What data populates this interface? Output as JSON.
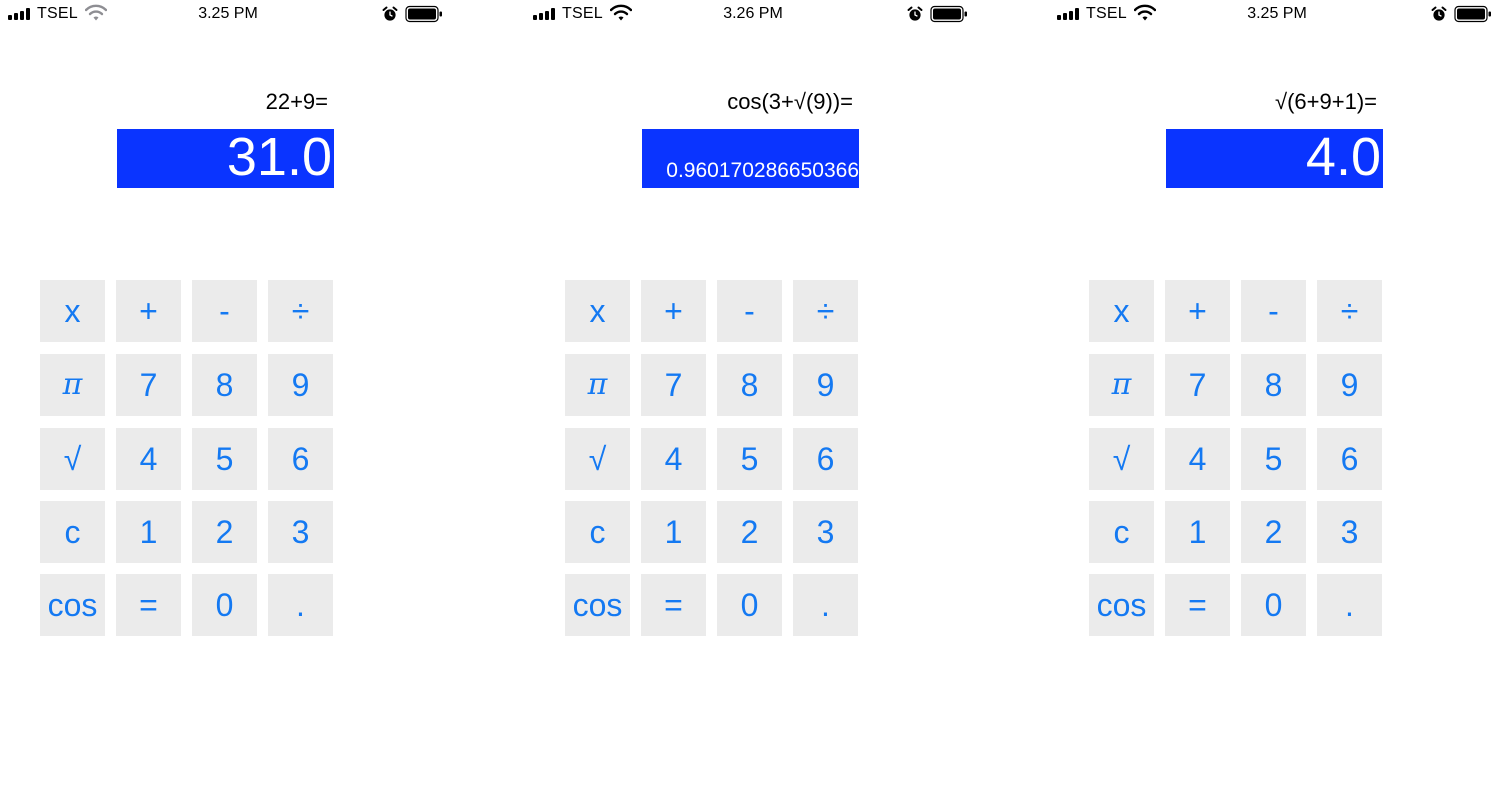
{
  "screens": [
    {
      "status": {
        "carrier": "TSEL",
        "time": "3.25 PM"
      },
      "expression": "22+9=",
      "result": "31.0",
      "result_size": "big",
      "wifi_color": "#8e8e93"
    },
    {
      "status": {
        "carrier": "TSEL",
        "time": "3.26 PM"
      },
      "expression": "cos(3+√(9))=",
      "result": "0.960170286650366",
      "result_size": "small",
      "wifi_color": "#000000"
    },
    {
      "status": {
        "carrier": "TSEL",
        "time": "3.25 PM"
      },
      "expression": "√(6+9+1)=",
      "result": "4.0",
      "result_size": "big",
      "wifi_color": "#000000"
    }
  ],
  "keys": [
    [
      "x",
      "+",
      "-",
      "÷"
    ],
    [
      "π",
      "7",
      "8",
      "9"
    ],
    [
      "√",
      "4",
      "5",
      "6"
    ],
    [
      "c",
      "1",
      "2",
      "3"
    ],
    [
      "cos",
      "=",
      "0",
      "."
    ]
  ],
  "key_names": [
    [
      "multiply-key",
      "plus-key",
      "minus-key",
      "divide-key"
    ],
    [
      "pi-key",
      "digit-7-key",
      "digit-8-key",
      "digit-9-key"
    ],
    [
      "sqrt-key",
      "digit-4-key",
      "digit-5-key",
      "digit-6-key"
    ],
    [
      "clear-key",
      "digit-1-key",
      "digit-2-key",
      "digit-3-key"
    ],
    [
      "cos-key",
      "equals-key",
      "digit-0-key",
      "decimal-key"
    ]
  ],
  "colors": {
    "result_background": "#0a34ff",
    "result_text": "#ffffff",
    "key_background": "#ebebeb",
    "key_text": "#1479f2"
  },
  "icons": {
    "signal": "cellular-signal-icon",
    "wifi": "wifi-icon",
    "alarm": "alarm-clock-icon",
    "battery": "battery-icon"
  }
}
